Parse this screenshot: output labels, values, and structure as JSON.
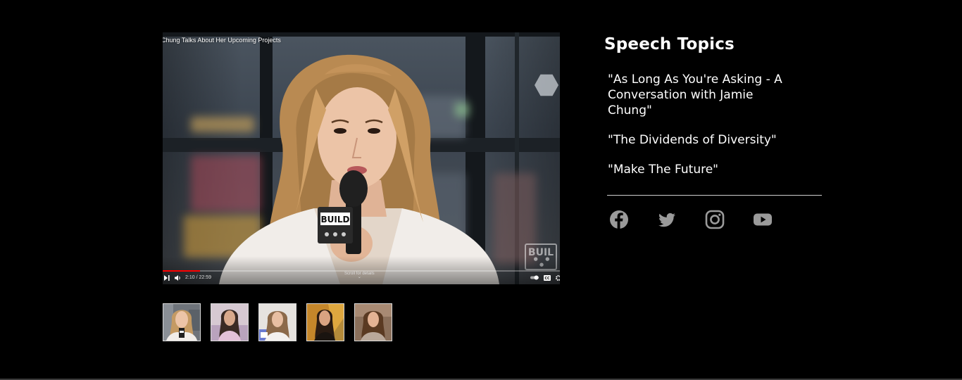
{
  "video": {
    "title": "Chung Talks About Her Upcoming Projects",
    "time": "2:10 / 22:59",
    "scroll_hint": "Scroll for details",
    "progress": 0.094,
    "mic_label": "BUILD",
    "watermark": "BUIL",
    "controls": {
      "next_icon": "skip-next-icon",
      "volume_icon": "volume-icon",
      "autoplay_icon": "autoplay-toggle-icon",
      "captions_icon": "captions-icon",
      "captions_label": "CC",
      "settings_icon": "settings-icon"
    }
  },
  "thumbnails": [
    {
      "name": "thumbnail-1",
      "selected": true
    },
    {
      "name": "thumbnail-2",
      "selected": false
    },
    {
      "name": "thumbnail-3",
      "selected": false
    },
    {
      "name": "thumbnail-4",
      "selected": false
    },
    {
      "name": "thumbnail-5",
      "selected": false
    }
  ],
  "speech_topics": {
    "heading": "Speech Topics",
    "items": [
      "\"As Long As You're Asking - A Conversation with Jamie Chung\"",
      "\"The Dividends of Diversity\"",
      "\"Make The Future\""
    ]
  },
  "social": [
    {
      "icon": "facebook-icon"
    },
    {
      "icon": "twitter-icon"
    },
    {
      "icon": "instagram-icon"
    },
    {
      "icon": "youtube-icon"
    }
  ],
  "colors": {
    "background": "#000000",
    "text": "#ffffff",
    "progress": "#ff0000",
    "social_icon": "#9a9a9a",
    "divider": "#cfcfcf"
  }
}
